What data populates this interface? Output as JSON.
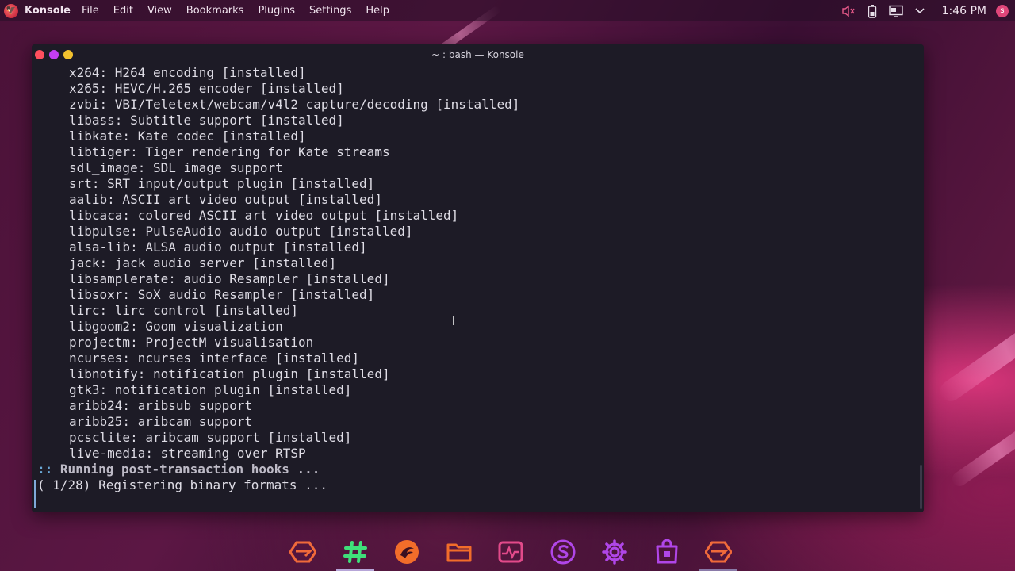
{
  "panel": {
    "app_name": "Konsole",
    "menu": [
      "File",
      "Edit",
      "View",
      "Bookmarks",
      "Plugins",
      "Settings",
      "Help"
    ],
    "clock": "1:46 PM",
    "tray_icons": [
      "volume-muted-icon",
      "battery-icon",
      "display-icon",
      "chevron-down-icon"
    ]
  },
  "window": {
    "title": "~ : bash — Konsole",
    "buttons": [
      "close",
      "minimize",
      "maximize"
    ]
  },
  "terminal": {
    "lines": [
      "x264: H264 encoding [installed]",
      "x265: HEVC/H.265 encoder [installed]",
      "zvbi: VBI/Teletext/webcam/v4l2 capture/decoding [installed]",
      "libass: Subtitle support [installed]",
      "libkate: Kate codec [installed]",
      "libtiger: Tiger rendering for Kate streams",
      "sdl_image: SDL image support",
      "srt: SRT input/output plugin [installed]",
      "aalib: ASCII art video output [installed]",
      "libcaca: colored ASCII art video output [installed]",
      "libpulse: PulseAudio audio output [installed]",
      "alsa-lib: ALSA audio output [installed]",
      "jack: jack audio server [installed]",
      "libsamplerate: audio Resampler [installed]",
      "libsoxr: SoX audio Resampler [installed]",
      "lirc: lirc control [installed]",
      "libgoom2: Goom visualization",
      "projectm: ProjectM visualisation",
      "ncurses: ncurses interface [installed]",
      "libnotify: notification plugin [installed]",
      "gtk3: notification plugin [installed]",
      "aribb24: aribsub support",
      "aribb25: aribcam support",
      "pcsclite: aribcam support [installed]",
      "live-media: streaming over RTSP"
    ],
    "hook_prefix": "::",
    "hook_text": "Running post-transaction hooks ...",
    "progress_line": "( 1/28) Registering binary formats ..."
  },
  "dock": {
    "items": [
      {
        "name": "app-launcher-icon",
        "color": "#f06a3a"
      },
      {
        "name": "hashtag-icon",
        "color": "#3fe07a"
      },
      {
        "name": "garuda-dragon-icon",
        "color": "#f26d2a"
      },
      {
        "name": "folder-icon",
        "color": "#f26d2a"
      },
      {
        "name": "system-monitor-icon",
        "color": "#e24a8a"
      },
      {
        "name": "s-app-icon",
        "color": "#b046e8"
      },
      {
        "name": "settings-gear-icon",
        "color": "#b046e8"
      },
      {
        "name": "store-bag-icon",
        "color": "#b046e8"
      },
      {
        "name": "garuda-launcher-icon",
        "color": "#f06a3a"
      }
    ]
  }
}
